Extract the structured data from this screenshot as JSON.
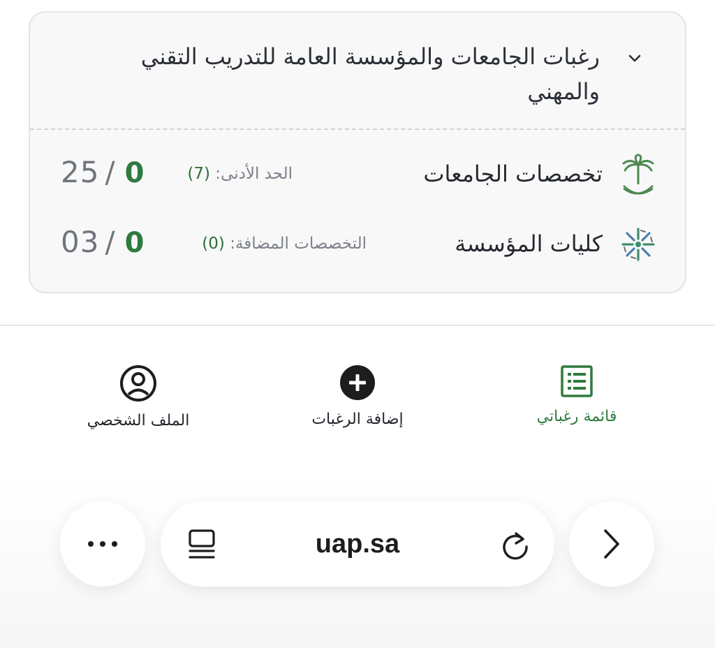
{
  "card": {
    "title": "رغبات الجامعات والمؤسسة العامة للتدريب التقني والمهني",
    "rows": [
      {
        "label": "تخصصات الجامعات",
        "note_text": "الحد الأدنى:",
        "note_value": "(7)",
        "count_current": "0",
        "count_max": "25",
        "logo": "saudi-emblem-icon"
      },
      {
        "label": "كليات المؤسسة",
        "note_text": "التخصصات المضافة:",
        "note_value": "(0)",
        "count_current": "0",
        "count_max": "03",
        "logo": "tvtc-logo-icon"
      }
    ]
  },
  "nav": {
    "wishlist": "قائمة رغباتي",
    "add": "إضافة الرغبات",
    "profile": "الملف الشخصي"
  },
  "browser": {
    "url": "uap.sa"
  },
  "colors": {
    "accent_green": "#2f7a3e",
    "card_bg": "#f8f8f9",
    "muted_text": "#70757c"
  }
}
